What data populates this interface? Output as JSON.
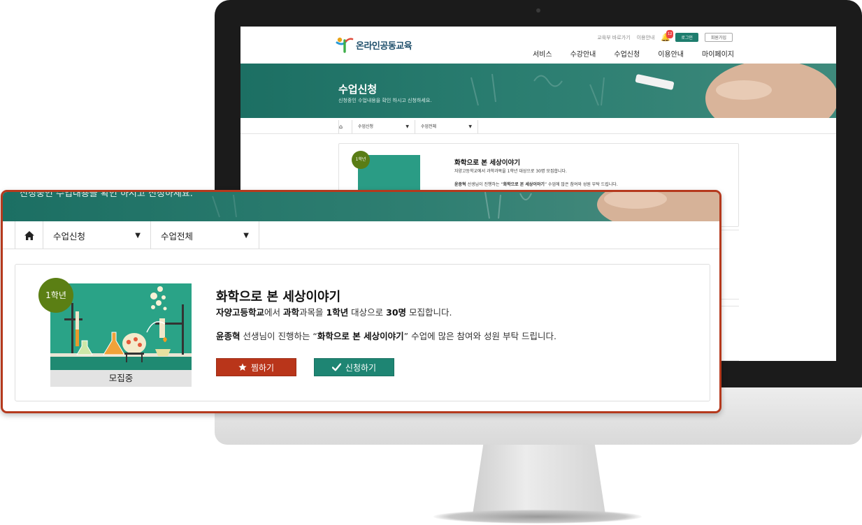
{
  "site": {
    "logo_text": "온라인공동교육",
    "util_links": [
      "교육부 바로가기",
      "이용안내"
    ],
    "notification_count": "12",
    "login_label": "로그인",
    "signup_label": "회원가입",
    "nav": [
      "서비스",
      "수강안내",
      "수업신청",
      "이용안내",
      "마이페이지"
    ]
  },
  "hero": {
    "title": "수업신청",
    "subtitle": "신청중인 수업내용을 확인 하시고 신청하세요."
  },
  "breadcrumb": {
    "level1": "수업신청",
    "level2": "수업전체"
  },
  "course": {
    "grade_badge": "1학년",
    "title": "화학으로 본 세상이야기",
    "school": "자양고등학교",
    "subject": "과학",
    "grade": "1학년",
    "capacity": "30명",
    "desc1_a": "에서 ",
    "desc1_b": "과목을 ",
    "desc1_c": " 대상으로 ",
    "desc1_d": " 모집합니다.",
    "teacher": "윤종혁",
    "desc2_a": " 선생님이 진행하는 “",
    "desc2_b": "” 수업에 많은 참여와 성원 부탁 드립니다.",
    "status": "모집중",
    "like_label": "찜하기",
    "apply_label": "신청하기"
  },
  "colors": {
    "accent_green": "#1e8573",
    "like_red": "#b9351a",
    "badge_green": "#5b7f14",
    "highlight_border": "#b5391d"
  },
  "icons": [
    "home-icon",
    "star-icon",
    "check-icon",
    "bell-icon",
    "dropdown-arrow-icon"
  ]
}
